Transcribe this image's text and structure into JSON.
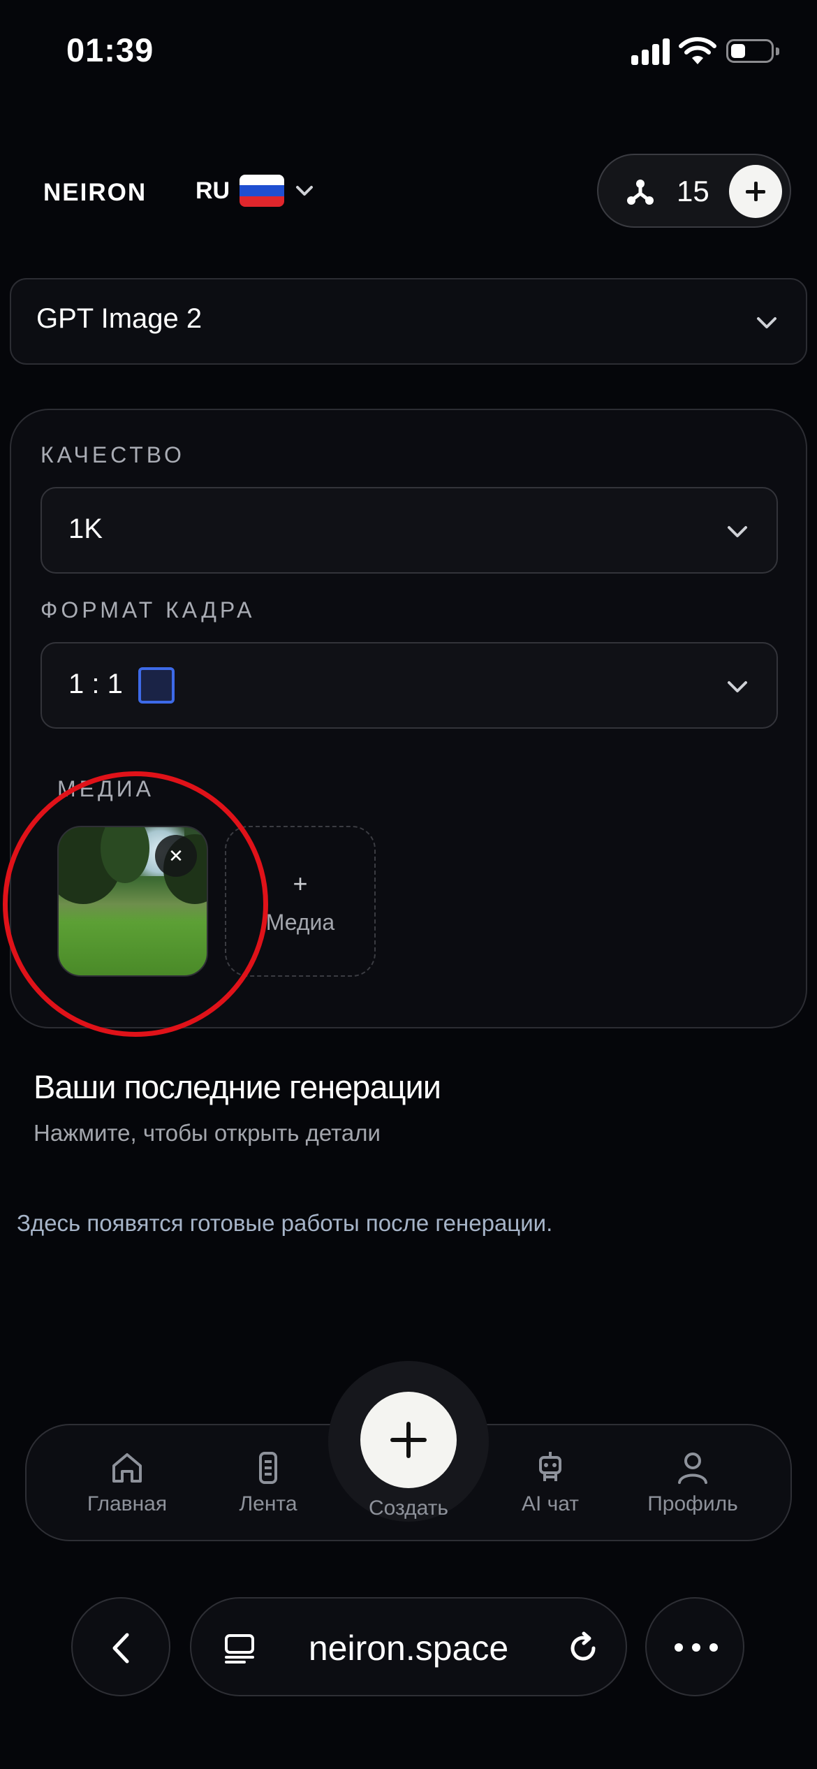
{
  "status_bar": {
    "time": "01:39"
  },
  "header": {
    "logo": "NEIRON",
    "language": "RU",
    "credits": "15"
  },
  "model": {
    "value": "GPT Image 2"
  },
  "settings": {
    "quality_label": "КАЧЕСТВО",
    "quality_value": "1K",
    "format_label": "ФОРМАТ КАДРА",
    "format_value": "1 : 1",
    "media_label": "МЕДИА",
    "media_add_label": "Медиа"
  },
  "recent": {
    "title": "Ваши последние генерации",
    "subtitle": "Нажмите, чтобы открыть детали",
    "empty": "Здесь появятся готовые работы после генерации."
  },
  "nav": {
    "items": [
      {
        "label": "Главная",
        "icon": "home-icon"
      },
      {
        "label": "Лента",
        "icon": "feed-icon"
      },
      {
        "label": "Создать",
        "icon": "plus-icon"
      },
      {
        "label": "AI чат",
        "icon": "robot-icon"
      },
      {
        "label": "Профиль",
        "icon": "profile-icon"
      }
    ]
  },
  "browser": {
    "url": "neiron.space"
  },
  "colors": {
    "background": "#05060a",
    "accent_blue": "#3d6ae8",
    "highlight_red": "#e01219"
  }
}
